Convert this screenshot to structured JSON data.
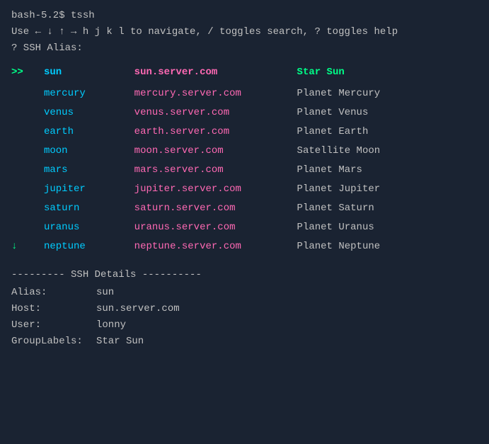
{
  "terminal": {
    "prompt": "bash-5.2$ tssh",
    "help_line": "Use ← ↓ ↑ → h j k l to navigate, / toggles search, ? toggles help",
    "ssh_alias_label": "? SSH Alias:",
    "divider": "--------- SSH Details ----------"
  },
  "table": {
    "headers": {
      "indicator": ">>",
      "alias": "sun",
      "host": "sun.server.com",
      "label": "Star Sun"
    },
    "rows": [
      {
        "indicator": "",
        "alias": "mercury",
        "host": "mercury.server.com",
        "label": "Planet Mercury"
      },
      {
        "indicator": "",
        "alias": "venus",
        "host": "venus.server.com",
        "label": "Planet Venus"
      },
      {
        "indicator": "",
        "alias": "earth",
        "host": "earth.server.com",
        "label": "Planet Earth"
      },
      {
        "indicator": "",
        "alias": "moon",
        "host": "moon.server.com",
        "label": "Satellite Moon"
      },
      {
        "indicator": "",
        "alias": "mars",
        "host": "mars.server.com",
        "label": "Planet Mars"
      },
      {
        "indicator": "",
        "alias": "jupiter",
        "host": "jupiter.server.com",
        "label": "Planet Jupiter"
      },
      {
        "indicator": "",
        "alias": "saturn",
        "host": "saturn.server.com",
        "label": "Planet Saturn"
      },
      {
        "indicator": "",
        "alias": "uranus",
        "host": "uranus.server.com",
        "label": "Planet Uranus"
      },
      {
        "indicator": "↓",
        "alias": "neptune",
        "host": "neptune.server.com",
        "label": "Planet Neptune"
      }
    ]
  },
  "details": {
    "alias_label": "Alias:",
    "alias_value": "sun",
    "host_label": "Host:",
    "host_value": "sun.server.com",
    "user_label": "User:",
    "user_value": "lonny",
    "group_label": "GroupLabels:",
    "group_value": "Star Sun"
  }
}
